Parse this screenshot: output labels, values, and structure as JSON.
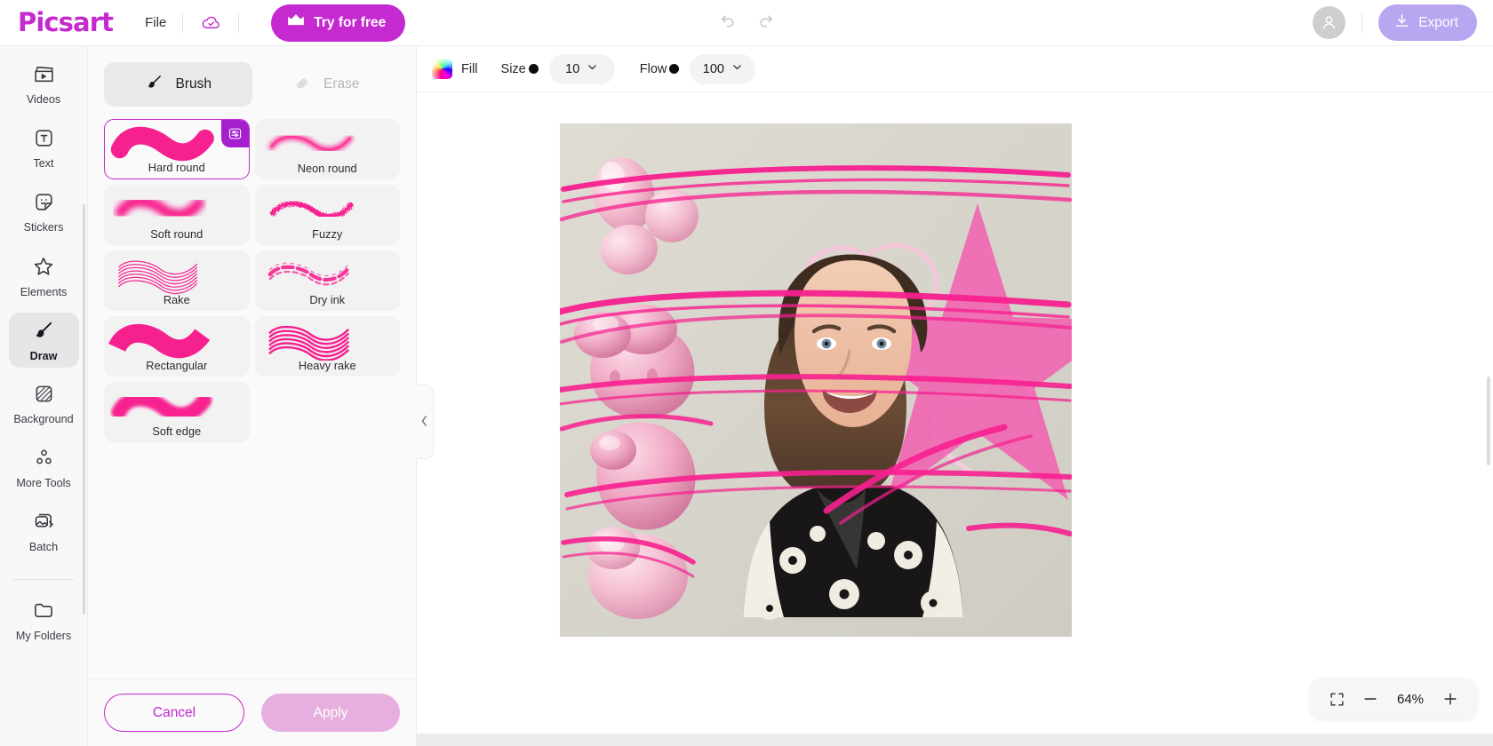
{
  "header": {
    "logo": "Picsart",
    "file_menu": "File",
    "cloud_icon": "cloud-saved-icon",
    "try_button": {
      "label": "Try for free",
      "icon": "crown-icon",
      "color": "#c42ad0"
    },
    "undo_icon": "undo-arrow-icon",
    "redo_icon": "redo-arrow-icon",
    "avatar_icon": "user-avatar-icon",
    "export_button": {
      "label": "Export",
      "icon": "download-icon",
      "color": "#b9a6f0"
    }
  },
  "sidebar": {
    "items": [
      {
        "label": "Videos",
        "icon": "clapperboard-icon",
        "active": false
      },
      {
        "label": "Text",
        "icon": "text-box-icon",
        "active": false
      },
      {
        "label": "Stickers",
        "icon": "sticker-icon",
        "active": false
      },
      {
        "label": "Elements",
        "icon": "star-outline-icon",
        "active": false
      },
      {
        "label": "Draw",
        "icon": "paintbrush-icon",
        "active": true
      },
      {
        "label": "Background",
        "icon": "hatched-square-icon",
        "active": false
      },
      {
        "label": "More Tools",
        "icon": "grid-dots-icon",
        "active": false
      },
      {
        "label": "Batch",
        "icon": "stacked-photos-icon",
        "active": false
      }
    ],
    "footer_item": {
      "label": "My Folders",
      "icon": "folder-icon"
    }
  },
  "panel": {
    "tabs": [
      {
        "label": "Brush",
        "icon": "paintbrush-icon",
        "active": true
      },
      {
        "label": "Erase",
        "icon": "eraser-icon",
        "active": false
      }
    ],
    "brushes": [
      {
        "name": "Hard round",
        "selected": true,
        "badge_icon": "brush-settings-icon"
      },
      {
        "name": "Neon round",
        "selected": false
      },
      {
        "name": "Soft round",
        "selected": false
      },
      {
        "name": "Fuzzy",
        "selected": false
      },
      {
        "name": "Rake",
        "selected": false
      },
      {
        "name": "Dry ink",
        "selected": false
      },
      {
        "name": "Rectangular",
        "selected": false
      },
      {
        "name": "Heavy rake",
        "selected": false
      },
      {
        "name": "Soft edge",
        "selected": false
      }
    ],
    "collapse_icon": "chevron-left-icon",
    "cancel_label": "Cancel",
    "apply_label": "Apply"
  },
  "toolbar": {
    "color_swatch_icon": "rainbow-color-swatch",
    "fill_label": "Fill",
    "size_label": "Size",
    "size_value": "10",
    "flow_label": "Flow",
    "flow_value": "100",
    "chevron_icon": "chevron-down-icon"
  },
  "canvas": {
    "description": "Portrait photo of a smiling woman with shoulder-length brown hair wearing a black floral-print shirt, decorated with pink 3D balloon shapes, a large pink star and magenta brush strokes"
  },
  "zoom_control": {
    "fit_icon": "fit-to-screen-icon",
    "minus_icon": "minus-icon",
    "value": "64%",
    "plus_icon": "plus-icon"
  },
  "colors": {
    "brand": "#c42ad0",
    "export": "#b9a6f0",
    "brush_pink": "#f7208f"
  }
}
